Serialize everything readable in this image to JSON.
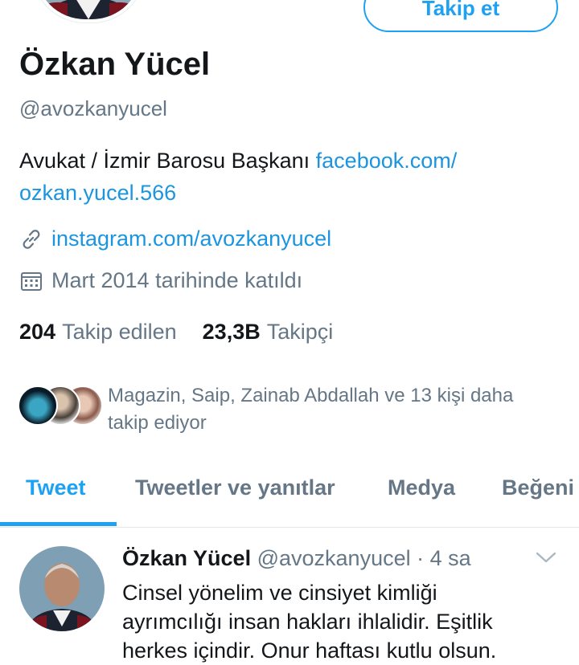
{
  "profile": {
    "name": "Özkan Yücel",
    "handle": "@avozkanyucel",
    "bio_text": "Avukat / İzmir Barosu Başkanı ",
    "bio_link_1": "facebook.com/",
    "bio_link_2": "ozkan.yucel.566",
    "website": "instagram.com/avozkanyucel",
    "joined": "Mart 2014 tarihinde katıldı",
    "following_count": "204",
    "following_label": "Takip edilen",
    "followers_count": "23,3B",
    "followers_label": "Takipçi",
    "followed_by_line1": "Magazin, Saip, Zainab Abdallah ve 13 kişi daha",
    "followed_by_line2": "takip ediyor"
  },
  "follow_button": {
    "label": "Takip et"
  },
  "tabs": [
    {
      "label": "Tweet",
      "active": true
    },
    {
      "label": "Tweetler ve yanıtlar",
      "active": false
    },
    {
      "label": "Medya",
      "active": false
    },
    {
      "label": "Beğeni",
      "active": false
    }
  ],
  "tweet": {
    "name": "Özkan Yücel",
    "handle": "@avozkanyucel",
    "separator": "·",
    "time": "4 sa",
    "line1": "Cinsel yönelim ve cinsiyet kimliği",
    "line2": "ayrımcılığı insan hakları ihlalidir. Eşitlik",
    "line3": "herkes içindir. Onur haftası kutlu olsun."
  },
  "colors": {
    "accent": "#1da1f2",
    "link": "#1b95e0",
    "secondary_text": "#657786"
  },
  "icons": [
    "link-icon",
    "calendar-icon",
    "chevron-down-icon"
  ]
}
